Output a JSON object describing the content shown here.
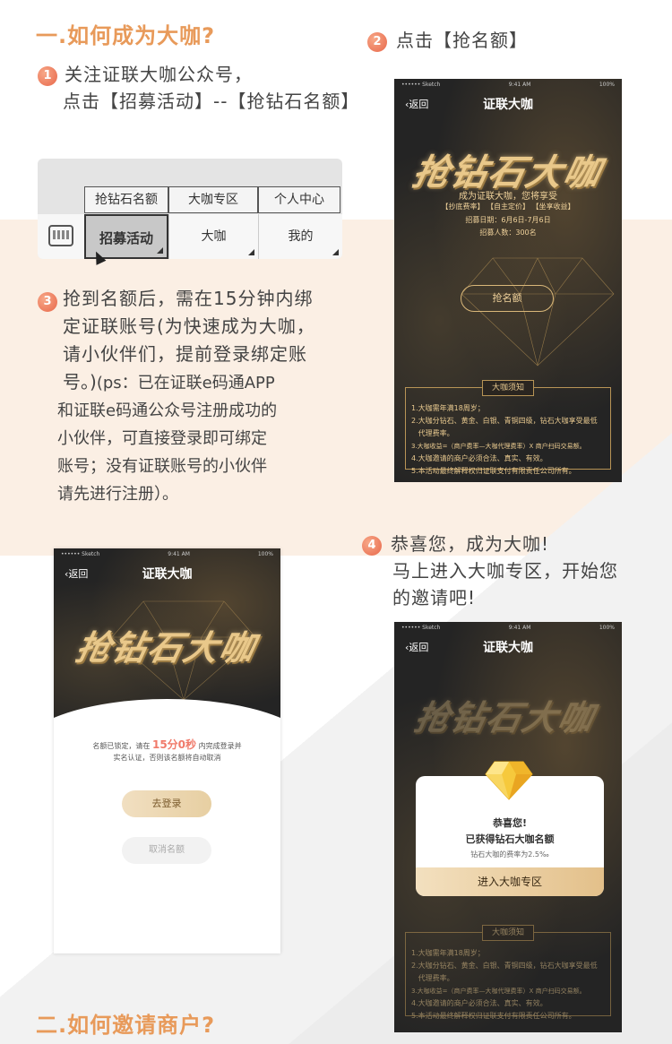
{
  "sections": {
    "title1": "一.如何成为大咖?",
    "title2": "二.如何邀请商户?"
  },
  "step1": {
    "num": "1",
    "line1": "关注证联大咖公众号，",
    "line2": "点击【招募活动】--【抢钻石名额】"
  },
  "step2": {
    "num": "2",
    "text": "点击【抢名额】"
  },
  "step3": {
    "num": "3",
    "lines_big": [
      "抢到名额后，需在15分钟内绑",
      "定证联账号(为快速成为大咖，",
      "请小伙伴们，提前登录绑定账",
      "号。)"
    ],
    "ps_inline": "(ps：已在证联e码通APP",
    "lines_small": [
      "和证联e码通公众号注册成功的",
      "小伙伴，可直接登录即可绑定",
      "账号；没有证联账号的小伙伴",
      "请先进行注册）。"
    ]
  },
  "step4": {
    "num": "4",
    "line1": "恭喜您，成为大咖!",
    "line2": "马上进入大咖专区，开始您",
    "line3": "的邀请吧!"
  },
  "menu": {
    "popup": [
      "抢钻石名额",
      "大咖专区",
      "个人中心"
    ],
    "items": [
      "招募活动",
      "大咖",
      "我的"
    ]
  },
  "phone_common": {
    "carrier": "•••••• Sketch",
    "time": "9:41 AM",
    "battery": "100%",
    "back": "返回",
    "title": "证联大咖"
  },
  "phone1": {
    "headline": "抢钻石大咖",
    "subtitle": "成为证联大咖，您将享受",
    "benefits": "【抄底费率】 【自主定价】 【坐享收益】",
    "date": "招募日期：6月6日-7月6日",
    "count": "招募人数：300名",
    "grab_button": "抢名额",
    "rules_title": "大咖须知",
    "rules": [
      "1.大咖需年满18周岁；",
      "2.大咖分钻石、黄金、白银、青铜四级，钻石大咖享受最低",
      "   代理费率。",
      "3.大咖收益=（商户费率—大咖代理费率）X 商户扫码交易额。",
      "4.大咖邀请的商户必须合法、真实、有效。",
      "5.本活动最终解释权归证联支付有限责任公司所有。"
    ]
  },
  "phone2": {
    "headline": "抢钻石大咖",
    "locked_prefix": "名额已锁定，请在",
    "countdown": "15分0秒",
    "locked_suffix": "内完成登录并",
    "locked_line2": "实名认证，否则该名额将自动取消",
    "login_button": "去登录",
    "cancel_button": "取消名额",
    "countdown_color": "#f07a6a"
  },
  "phone3": {
    "headline": "抢钻石大咖",
    "congrats": "恭喜您!",
    "obtained": "已获得钻石大咖名额",
    "rate": "钻石大咖的费率为2.5‰",
    "enter_button": "进入大咖专区",
    "rules_title": "大咖须知",
    "rules": [
      "1.大咖需年满18周岁；",
      "2.大咖分钻石、黄金、白银、青铜四级，钻石大咖享受最低",
      "   代理费率。",
      "3.大咖收益=（商户费率—大咖代理费率）X 商户扫码交易额。",
      "4.大咖邀请的商户必须合法、真实、有效。",
      "5.本活动最终解释权归证联支付有限责任公司所有。"
    ]
  },
  "colors": {
    "accent": "#e89a5a",
    "gold": "#e9c88a",
    "step": "#e8674a"
  }
}
